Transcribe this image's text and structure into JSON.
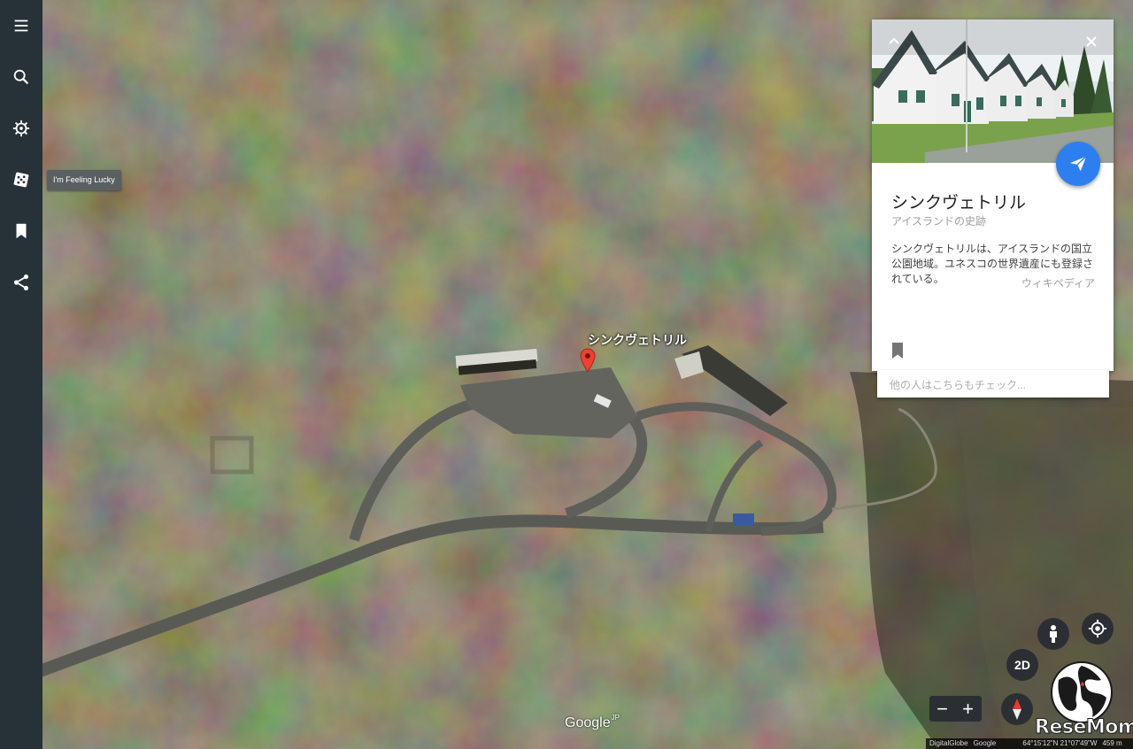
{
  "rail": {
    "items": [
      {
        "name": "menu-icon",
        "label": "Menu"
      },
      {
        "name": "search-icon",
        "label": "Search"
      },
      {
        "name": "voyager-icon",
        "label": "Voyager"
      },
      {
        "name": "dice-icon",
        "label": "I'm Feeling Lucky"
      },
      {
        "name": "bookmark-icon",
        "label": "My Places"
      },
      {
        "name": "share-icon",
        "label": "Share"
      }
    ],
    "tooltip": "I'm Feeling Lucky"
  },
  "map": {
    "pin_label": "シンクヴェトリル",
    "logo": "Google",
    "logo_region": "JP"
  },
  "card": {
    "title": "シンクヴェトリル",
    "subtitle": "アイスランドの史跡",
    "description": "シンクヴェトリルは、アイスランドの国立公園地域。ユネスコの世界遺産にも登録されている。",
    "source": "ウィキペディア",
    "also_search": "他の人はこちらもチェック..."
  },
  "controls": {
    "mode_2d": "2D",
    "zoom_out": "−",
    "zoom_in": "+"
  },
  "footer": {
    "attribution_1": "DigitalGlobe",
    "attribution_2": "Google",
    "coords": "64°15'12\"N 21°07'49\"W",
    "altitude": "459 m"
  },
  "watermark": "ReseMom",
  "colors": {
    "rail_bg": "#263238",
    "fab": "#2d7ff0",
    "pin": "#ea4335"
  }
}
